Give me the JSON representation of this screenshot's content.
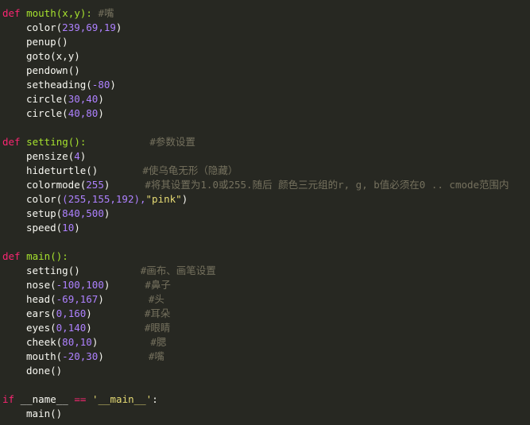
{
  "code": {
    "mouth_def": {
      "kw": "def",
      "name": "mouth",
      "params": "(x,y):",
      "comment": "#嘴",
      "body": [
        {
          "fn": "color",
          "open": "(",
          "args": "239,69,19",
          "close": ")"
        },
        {
          "fn": "penup",
          "open": "(",
          "args": "",
          "close": ")"
        },
        {
          "fn": "goto",
          "open": "(",
          "args": "x,y",
          "close": ")"
        },
        {
          "fn": "pendown",
          "open": "(",
          "args": "",
          "close": ")"
        },
        {
          "fn": "setheading",
          "open": "(",
          "args": "-80",
          "close": ")"
        },
        {
          "fn": "circle",
          "open": "(",
          "args": "30,40",
          "close": ")"
        },
        {
          "fn": "circle",
          "open": "(",
          "args": "40,80",
          "close": ")"
        }
      ]
    },
    "setting_def": {
      "kw": "def",
      "name": "setting",
      "params": "():",
      "comment": "#参数设置",
      "body": [
        {
          "fn": "pensize",
          "args": "4",
          "comment": ""
        },
        {
          "fn": "hideturtle",
          "args": "",
          "comment": "#使乌龟无形（隐藏）"
        },
        {
          "fn": "colormode",
          "args": "255",
          "comment": "#将其设置为1.0或255.随后 颜色三元组的r, g, b值必须在0 .. cmode范围内"
        },
        {
          "fn": "color",
          "args": "(255,155,192),",
          "str": "\"pink\"",
          "comment": ""
        },
        {
          "fn": "setup",
          "args": "840,500",
          "comment": ""
        },
        {
          "fn": "speed",
          "args": "10",
          "comment": ""
        }
      ]
    },
    "main_def": {
      "kw": "def",
      "name": "main",
      "params": "():",
      "body": [
        {
          "fn": "setting",
          "args": "",
          "comment": "#画布、画笔设置"
        },
        {
          "fn": "nose",
          "args": "-100,100",
          "comment": "#鼻子"
        },
        {
          "fn": "head",
          "args": "-69,167",
          "comment": "#头"
        },
        {
          "fn": "ears",
          "args": "0,160",
          "comment": "#耳朵"
        },
        {
          "fn": "eyes",
          "args": "0,140",
          "comment": "#眼睛"
        },
        {
          "fn": "cheek",
          "args": "80,10",
          "comment": "#腮"
        },
        {
          "fn": "mouth",
          "args": "-20,30",
          "comment": "#嘴"
        },
        {
          "fn": "done",
          "args": "",
          "comment": ""
        }
      ]
    },
    "if_block": {
      "kw": "if",
      "cond_a": "__name__",
      "op": "==",
      "str": "'__main__'",
      "colon": ":",
      "call": "main()"
    }
  },
  "colors": {
    "background": "#272822",
    "keyword": "#F92672",
    "function": "#A6E22E",
    "number": "#AE81FF",
    "string": "#E6DB74",
    "comment": "#75715E",
    "text": "#F8F8F2"
  }
}
